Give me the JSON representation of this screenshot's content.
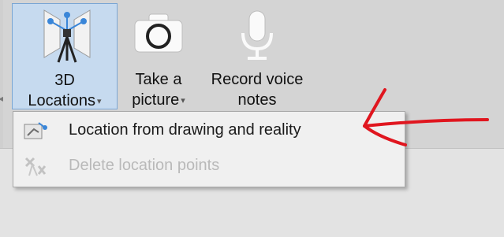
{
  "ribbon": {
    "buttons": [
      {
        "id": "3d",
        "line1": "3D",
        "line2": "Locations",
        "icon": "tripod-3d-icon"
      },
      {
        "id": "photo",
        "line1": "Take a",
        "line2": "picture",
        "icon": "camera-icon"
      },
      {
        "id": "voice",
        "line1": "Record voice",
        "line2": "notes",
        "icon": "microphone-icon"
      }
    ]
  },
  "menu": {
    "items": [
      {
        "label": "Location from drawing and reality",
        "enabled": true,
        "icon": "location-drawing-icon"
      },
      {
        "label": "Delete location points",
        "enabled": false,
        "icon": "delete-points-icon"
      }
    ]
  },
  "colors": {
    "ribbon_bg": "#d4d4d4",
    "selected_bg": "#c6daef",
    "selected_border": "#7aa6d4",
    "menu_bg": "#f0f0f0",
    "annotation": "#e0161f"
  }
}
